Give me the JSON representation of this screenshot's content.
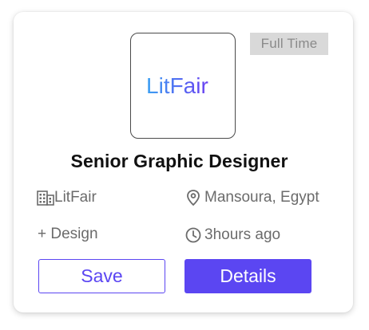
{
  "job": {
    "employment_type": "Full Time",
    "logo_text": "LitFair",
    "title": "Senior Graphic Designer",
    "company": "LitFair",
    "location": "Mansoura, Egypt",
    "category": "+ Design",
    "posted": "3hours ago"
  },
  "actions": {
    "save_label": "Save",
    "details_label": "Details"
  },
  "icons": {
    "company": "building-icon",
    "location": "location-pin-icon",
    "posted": "clock-icon"
  },
  "colors": {
    "accent": "#5b46f2",
    "logo_gradient_start": "#3aa0f2",
    "logo_gradient_end": "#6a3ff2",
    "badge_bg": "#d9d9d9",
    "meta_text": "#6b6b6b"
  }
}
